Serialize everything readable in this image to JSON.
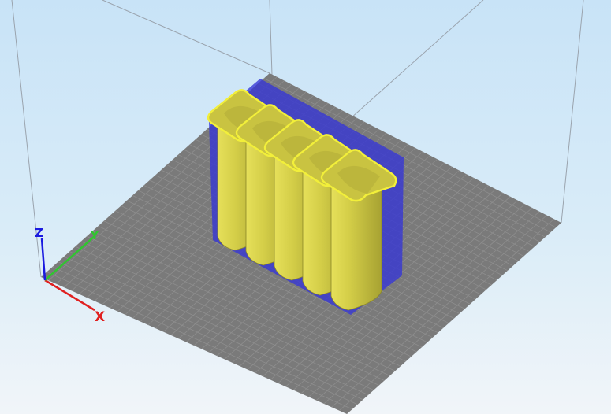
{
  "viewport": {
    "background_top": "#c8e3f7",
    "background_bottom": "#f1f5f9"
  },
  "bed": {
    "color": "#7a7a7a",
    "grid_line_color": "#8e8e8e"
  },
  "model": {
    "body_color": "#d8d24c",
    "rim_color": "#f2ef3a",
    "support_color": "#3434d6",
    "tubes": 5
  },
  "axes": {
    "x_label": "X",
    "y_label": "Y",
    "z_label": "Z",
    "x_color": "#e02020",
    "y_color": "#2ec72e",
    "z_color": "#1a1ae0"
  }
}
